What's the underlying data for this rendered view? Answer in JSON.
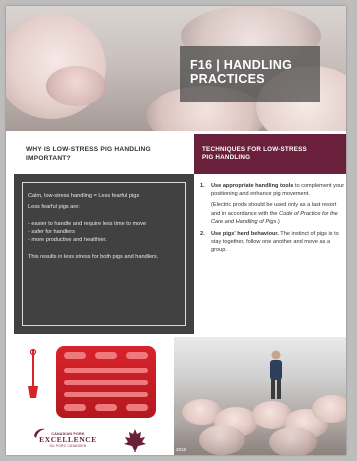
{
  "header": {
    "title_line1": "F16 | HANDLING",
    "title_line2": "PRACTICES"
  },
  "left_section": {
    "heading_line1": "WHY IS LOW-STRESS PIG HANDLING",
    "heading_line2": "IMPORTANT?",
    "box": {
      "line1": "Calm, low-stress handling = Less fearful pigs",
      "line2": "Less fearful pigs are:",
      "bullets": [
        "- easier to handle and require less time to move",
        "- safer for handlers",
        "- more productive and healthier."
      ],
      "conclusion": "This results in less stress for both pigs and handlers."
    }
  },
  "right_section": {
    "heading_line1": "TECHNIQUES FOR LOW-STRESS",
    "heading_line2": "PIG HANDLING",
    "items": [
      {
        "number": "1.",
        "lead": "Use appropriate handling tools",
        "text": " to complement your positioning and enhance pig movement."
      },
      {
        "number": "2.",
        "lead": "Use pigs' herd behaviour.",
        "text": " The instinct of pigs is to stay together, follow one another and move as a group."
      }
    ],
    "note_prefix": "(Electric prods should be used only as a last resort and in accordance with the ",
    "note_italic": "Code of Practice for the Care and Handling of Pigs",
    "note_suffix": ".)"
  },
  "footer": {
    "logo_line1": "CANADIAN PORK",
    "logo_line2": "EXCELLENCE",
    "logo_line3": "DU PORC CANADIEN",
    "year": "2018"
  },
  "colors": {
    "maroon": "#6a1f3a",
    "dark_box": "#414141",
    "board_red": "#d8232b"
  }
}
